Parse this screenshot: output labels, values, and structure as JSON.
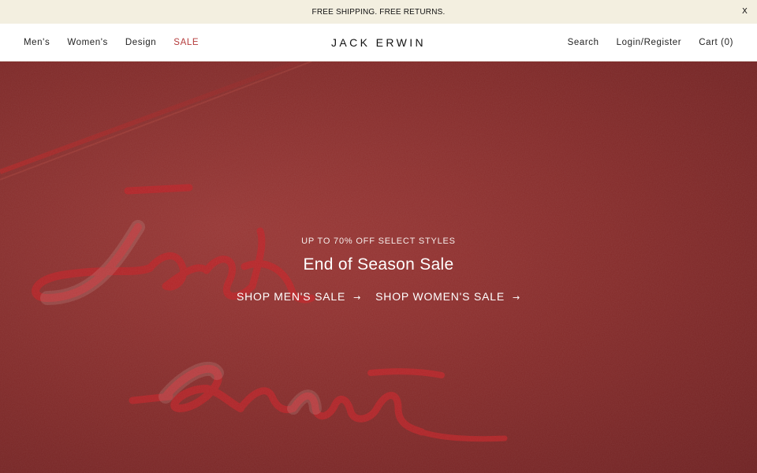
{
  "promo": {
    "message": "FREE SHIPPING. FREE RETURNS.",
    "close_label": "X"
  },
  "header": {
    "logo": "JACK ERWIN",
    "nav_left": [
      {
        "label": "Men's"
      },
      {
        "label": "Women's"
      },
      {
        "label": "Design"
      },
      {
        "label": "SALE"
      }
    ],
    "nav_right": [
      {
        "label": "Search"
      },
      {
        "label": "Login/Register"
      },
      {
        "label": "Cart (0)"
      }
    ]
  },
  "hero": {
    "eyebrow": "UP TO 70% OFF SELECT STYLES",
    "title": "End of Season Sale",
    "ctas": [
      {
        "label": "SHOP MEN'S SALE",
        "arrow": "→"
      },
      {
        "label": "SHOP WOMEN'S SALE",
        "arrow": "→"
      }
    ]
  },
  "colors": {
    "promo_bg": "#f3efe0",
    "hero_bg": "#8e2d2c",
    "sale_accent": "#b43a3a",
    "signature_red": "#c0262a"
  }
}
